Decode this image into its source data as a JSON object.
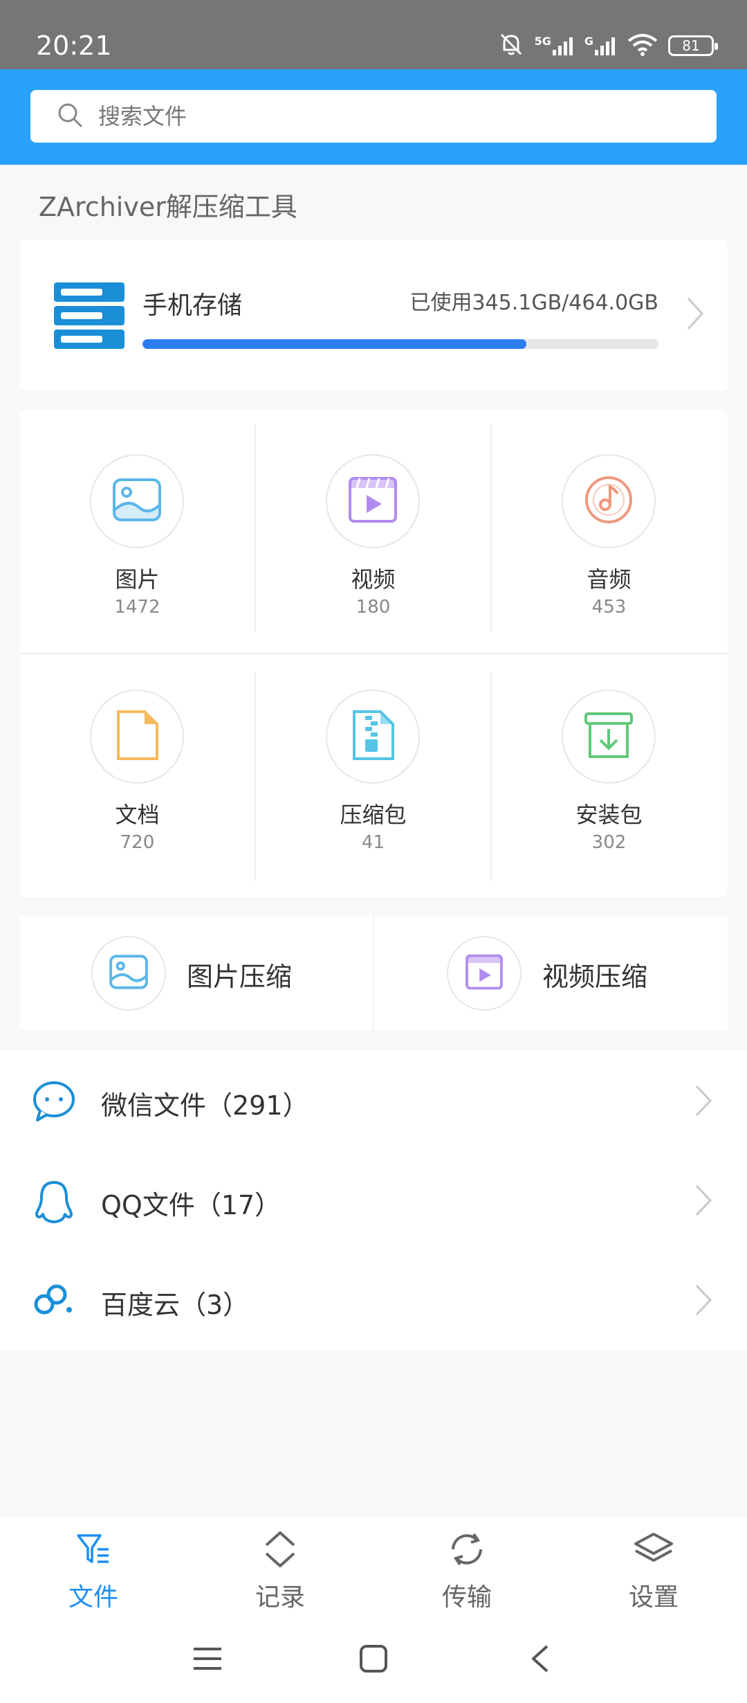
{
  "status_bar": {
    "time": "20:21",
    "battery": "81",
    "net1": "5G",
    "net2": "G"
  },
  "search": {
    "placeholder": "搜索文件"
  },
  "app_title": "ZArchiver解压缩工具",
  "storage": {
    "label": "手机存储",
    "usage": "已使用345.1GB/464.0GB",
    "used_fraction": 0.744
  },
  "categories": [
    {
      "name": "图片",
      "count": "1472",
      "icon": "image-icon",
      "color": "#5bb6ea"
    },
    {
      "name": "视频",
      "count": "180",
      "icon": "video-icon",
      "color": "#b18cf0"
    },
    {
      "name": "音频",
      "count": "453",
      "icon": "music-disc-icon",
      "color": "#f0977c"
    },
    {
      "name": "文档",
      "count": "720",
      "icon": "document-icon",
      "color": "#f6b95c"
    },
    {
      "name": "压缩包",
      "count": "41",
      "icon": "zip-icon",
      "color": "#56c4e6"
    },
    {
      "name": "安装包",
      "count": "302",
      "icon": "package-icon",
      "color": "#61c97a"
    }
  ],
  "compress": {
    "image_label": "图片压缩",
    "video_label": "视频压缩"
  },
  "sources": [
    {
      "label": "微信文件（291）",
      "icon": "wechat-icon"
    },
    {
      "label": "QQ文件（17）",
      "icon": "qq-icon"
    },
    {
      "label": "百度云（3）",
      "icon": "baidu-cloud-icon"
    }
  ],
  "nav": {
    "files": "文件",
    "history": "记录",
    "transfer": "传输",
    "settings": "设置"
  },
  "colors": {
    "header": "#2aa2fb",
    "accent": "#1e8ef4",
    "progress": "#2a7ef0",
    "list_icon": "#1a8fd8"
  }
}
